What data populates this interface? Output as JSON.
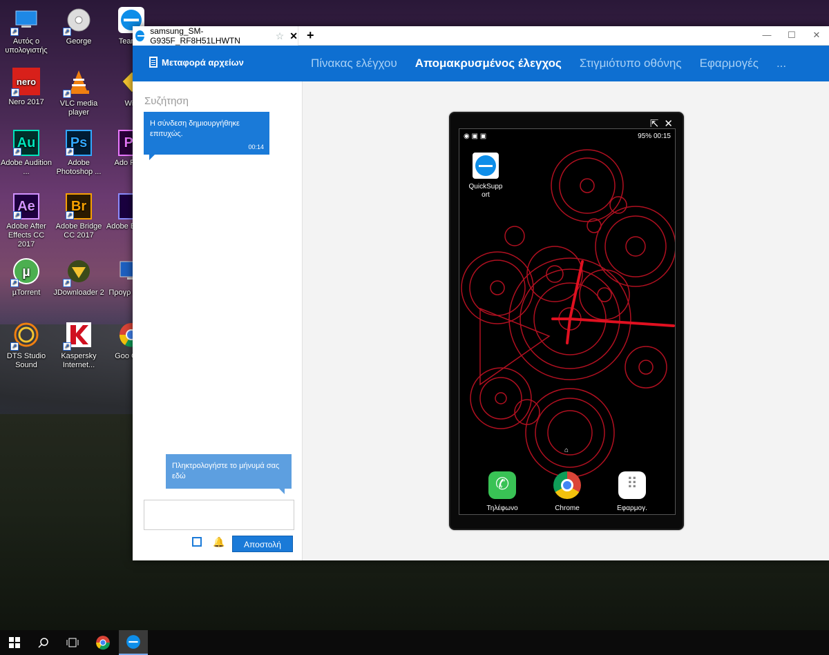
{
  "desktop": {
    "icons": [
      {
        "label": "Αυτός ο υπολογιστής",
        "icon": "computer-icon"
      },
      {
        "label": "George",
        "icon": "disc-icon"
      },
      {
        "label": "TeamVi",
        "icon": "teamviewer-icon"
      },
      {
        "label": "Nero 2017",
        "icon": "nero-icon"
      },
      {
        "label": "VLC media player",
        "icon": "vlc-icon"
      },
      {
        "label": "Win",
        "icon": "winrar-icon"
      },
      {
        "label": "Adobe Audition ...",
        "icon": "audition-icon"
      },
      {
        "label": "Adobe Photoshop ...",
        "icon": "photoshop-icon"
      },
      {
        "label": "Ado Prem",
        "icon": "premiere-icon"
      },
      {
        "label": "Adobe After Effects CC 2017",
        "icon": "after-effects-icon"
      },
      {
        "label": "Adobe Bridge CC 2017",
        "icon": "bridge-icon"
      },
      {
        "label": "Adobe Encode",
        "icon": "media-encoder-icon"
      },
      {
        "label": "µTorrent",
        "icon": "utorrent-icon"
      },
      {
        "label": "JDownloader 2",
        "icon": "jdownloader-icon"
      },
      {
        "label": "Προγρ εποπτ",
        "icon": "monitor-icon"
      },
      {
        "label": "DTS Studio Sound",
        "icon": "dts-icon"
      },
      {
        "label": "Kaspersky Internet...",
        "icon": "kaspersky-icon"
      },
      {
        "label": "Goo Chro",
        "icon": "chrome-icon"
      }
    ]
  },
  "window": {
    "tab_title": "samsung_SM-G935F_RF8H51LHWTN",
    "star": "☆",
    "close_tab": "✕",
    "new_tab": "+",
    "controls": {
      "minimize": "—",
      "maximize": "☐",
      "close": "✕"
    }
  },
  "nav": {
    "file_transfer": "Μεταφορά αρχείων",
    "tabs": [
      {
        "label": "Πίνακας ελέγχου",
        "active": false
      },
      {
        "label": "Απομακρυσμένος έλεγχος",
        "active": true
      },
      {
        "label": "Στιγμιότυπο οθόνης",
        "active": false
      },
      {
        "label": "Εφαρμογές",
        "active": false
      },
      {
        "label": "...",
        "active": false
      }
    ]
  },
  "chat": {
    "title": "Συζήτηση",
    "message": "Η σύνδεση δημιουργήθηκε επιτυχώς.",
    "message_time": "00:14",
    "input_hint": "Πληκτρολογήστε το μήνυμά σας εδώ",
    "input_value": "",
    "send_label": "Αποστολή"
  },
  "device": {
    "status_right": "95% 00:15",
    "apps": [
      {
        "label": "QuickSupp ort",
        "icon": "quicksupport-icon"
      }
    ],
    "dock": [
      {
        "label": "Τηλέφωνο",
        "icon": "phone-icon"
      },
      {
        "label": "Chrome",
        "icon": "chrome-icon"
      },
      {
        "label": "Εφαρμογ.",
        "icon": "apps-icon"
      }
    ]
  },
  "colors": {
    "accent": "#0e6fd1",
    "chat_bubble": "#1a7ad8",
    "hint_bubble": "#5d9fe0",
    "wallpaper_red": "#c01020"
  }
}
